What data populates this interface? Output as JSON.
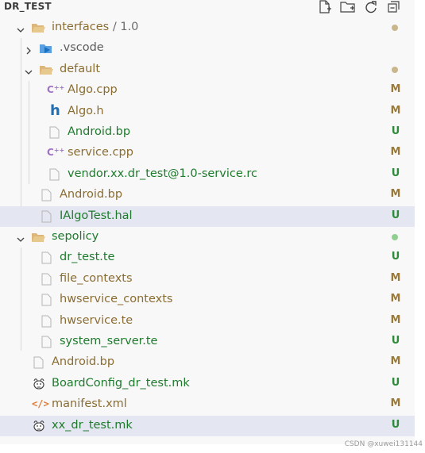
{
  "explorer": {
    "title": "DR_TEST",
    "toolbar": [
      "new-file-icon",
      "new-folder-icon",
      "refresh-icon",
      "collapse-all-icon"
    ]
  },
  "colors": {
    "modified": "#9a7a3a",
    "untracked": "#2e8b3a",
    "modified_text": "#8a6d32",
    "untracked_text": "#1f7a2e",
    "folder": "#dcb67a",
    "dot_modified": "#c9b68a",
    "dot_untracked": "#8fcf8f"
  },
  "tree": [
    {
      "label": "interfaces",
      "path": " / 1.0",
      "kind": "folder",
      "open": true,
      "status": "dot-m"
    },
    {
      "label": ".vscode",
      "kind": "vscode-folder",
      "open": false,
      "status": ""
    },
    {
      "label": "default",
      "kind": "folder",
      "open": true,
      "status": "dot-m"
    },
    {
      "label": "Algo.cpp",
      "kind": "cpp",
      "status": "M"
    },
    {
      "label": "Algo.h",
      "kind": "h",
      "status": "M"
    },
    {
      "label": "Android.bp",
      "kind": "file",
      "status": "U"
    },
    {
      "label": "service.cpp",
      "kind": "cpp",
      "status": "M"
    },
    {
      "label": "vendor.xx.dr_test@1.0-service.rc",
      "kind": "file",
      "status": "U"
    },
    {
      "label": "Android.bp",
      "kind": "file",
      "status": "M"
    },
    {
      "label": "IAlgoTest.hal",
      "kind": "file",
      "status": "U"
    },
    {
      "label": "sepolicy",
      "kind": "folder",
      "open": true,
      "status": "dot-u"
    },
    {
      "label": "dr_test.te",
      "kind": "file",
      "status": "U"
    },
    {
      "label": "file_contexts",
      "kind": "file",
      "status": "M"
    },
    {
      "label": "hwservice_contexts",
      "kind": "file",
      "status": "M"
    },
    {
      "label": "hwservice.te",
      "kind": "file",
      "status": "M"
    },
    {
      "label": "system_server.te",
      "kind": "file",
      "status": "U"
    },
    {
      "label": "Android.bp",
      "kind": "file",
      "status": "M"
    },
    {
      "label": "BoardConfig_dr_test.mk",
      "kind": "makefile",
      "status": "U"
    },
    {
      "label": "manifest.xml",
      "kind": "xml",
      "status": "M"
    },
    {
      "label": "xx_dr_test.mk",
      "kind": "makefile",
      "status": "U"
    }
  ],
  "watermark": "CSDN @xuwei131144"
}
